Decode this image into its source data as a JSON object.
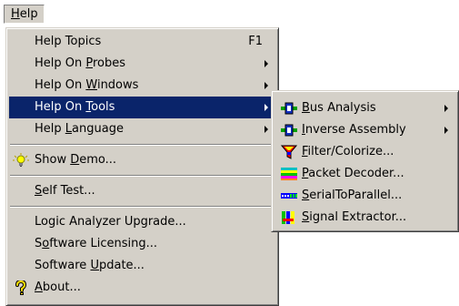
{
  "menubar": {
    "help": {
      "pre": "",
      "u": "H",
      "post": "elp"
    }
  },
  "help_menu": {
    "items": [
      {
        "pre": "Help Topics",
        "u": "",
        "post": "",
        "shortcut": "F1"
      },
      {
        "pre": "Help On ",
        "u": "P",
        "post": "robes",
        "submenu": true
      },
      {
        "pre": "Help On ",
        "u": "W",
        "post": "indows",
        "submenu": true
      },
      {
        "pre": "Help On ",
        "u": "T",
        "post": "ools",
        "submenu": true,
        "highlighted": true
      },
      {
        "pre": "Help ",
        "u": "L",
        "post": "anguage",
        "submenu": true
      },
      {
        "pre": "Show ",
        "u": "D",
        "post": "emo...",
        "icon": "lightbulb-icon"
      },
      {
        "pre": "",
        "u": "S",
        "post": "elf Test..."
      },
      {
        "pre": "Logic Analyzer Upgrade...",
        "u": "",
        "post": ""
      },
      {
        "pre": "S",
        "u": "o",
        "post": "ftware Licensing..."
      },
      {
        "pre": "Software ",
        "u": "U",
        "post": "pdate..."
      },
      {
        "pre": "",
        "u": "A",
        "post": "bout...",
        "icon": "help-question-icon"
      }
    ]
  },
  "tools_submenu": {
    "items": [
      {
        "pre": "",
        "u": "B",
        "post": "us Analysis",
        "submenu": true,
        "icon": "bus-analysis-icon"
      },
      {
        "pre": "",
        "u": "I",
        "post": "nverse Assembly",
        "submenu": true,
        "icon": "inverse-assembly-icon"
      },
      {
        "pre": "",
        "u": "F",
        "post": "ilter/Colorize...",
        "icon": "filter-colorize-icon"
      },
      {
        "pre": "",
        "u": "P",
        "post": "acket Decoder...",
        "icon": "packet-decoder-icon"
      },
      {
        "pre": "",
        "u": "S",
        "post": "erialToParallel...",
        "icon": "serial-to-parallel-icon"
      },
      {
        "pre": "",
        "u": "S",
        "post": "ignal Extractor...",
        "icon": "signal-extractor-icon"
      }
    ]
  },
  "colors": {
    "menu_face": "#d4d0c8",
    "highlight": "#0a246a",
    "highlight_text": "#ffffff"
  }
}
